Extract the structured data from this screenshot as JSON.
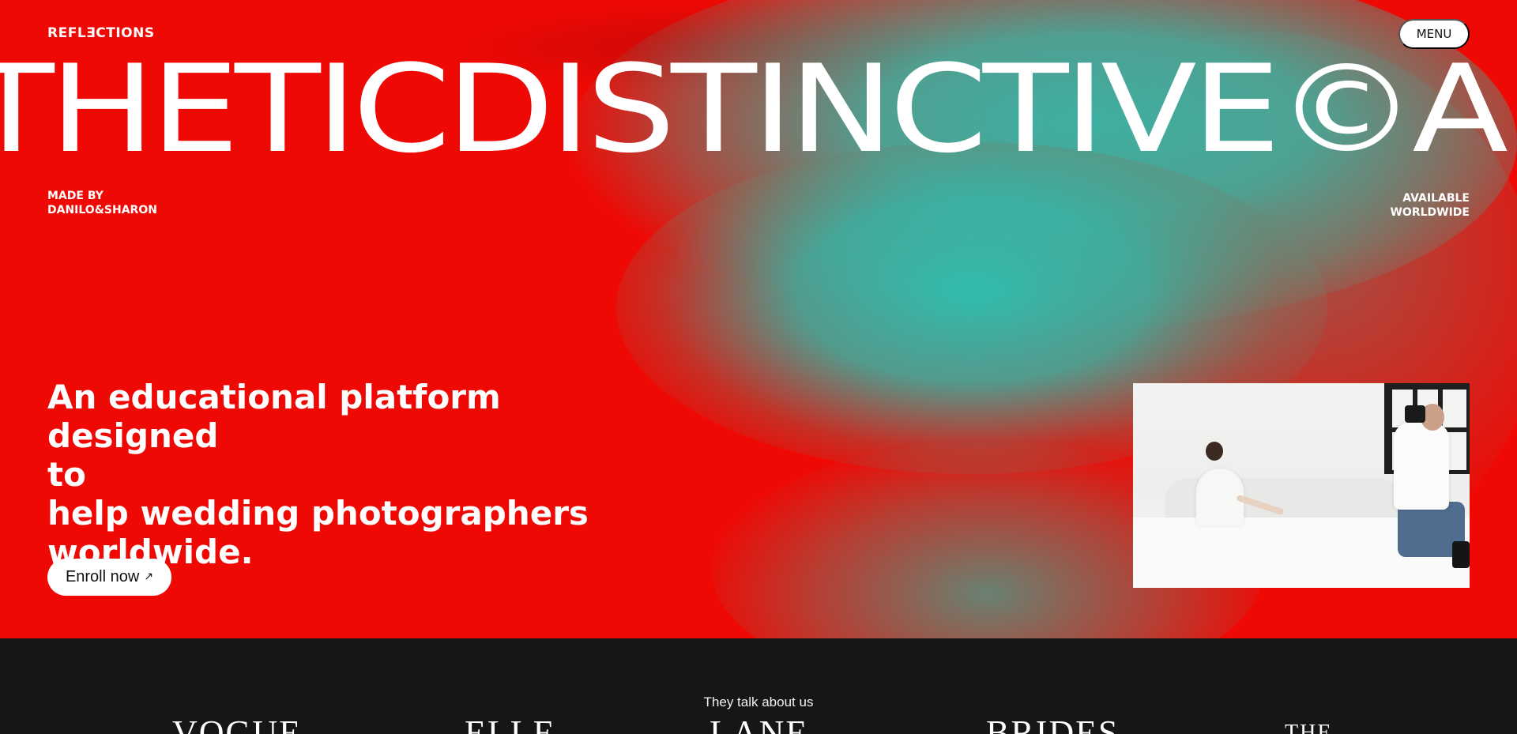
{
  "header": {
    "logo": "REFLƎCTIONS",
    "menu_label": "MENU"
  },
  "hero": {
    "marquee": "THETICDISTINCTIVE©A",
    "made_by_line1": "MADE BY",
    "made_by_line2": "DANILO&SHARON",
    "available_line1": "AVAILABLE",
    "available_line2": "WORLDWIDE",
    "tagline_line1": "An educational platform designed",
    "tagline_line2": "to",
    "tagline_line3": "help wedding photographers",
    "tagline_line4": "worldwide.",
    "enroll_label": "Enroll now",
    "enroll_icon": "↗",
    "colors": {
      "red": "#ef0904",
      "teal": "#34b9aa"
    }
  },
  "press": {
    "title": "They talk about us",
    "logos": [
      "VOGUE",
      "ELLE",
      "LANE",
      "BRIDES",
      "THE"
    ]
  }
}
